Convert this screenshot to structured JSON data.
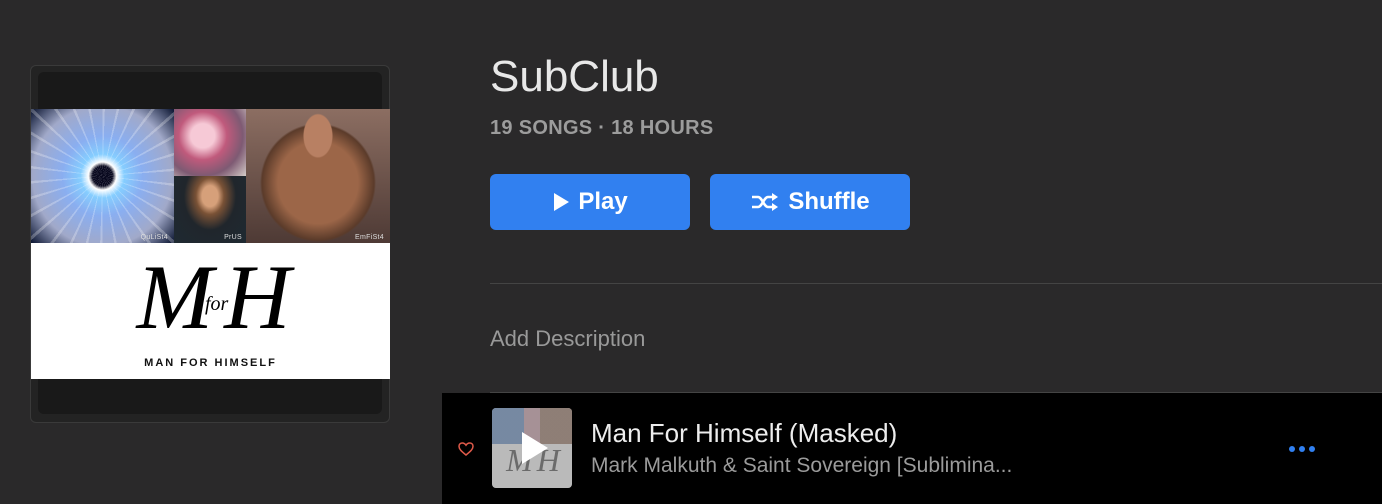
{
  "playlist": {
    "title": "SubClub",
    "meta": "19 SONGS · 18 HOURS",
    "add_description": "Add Description"
  },
  "buttons": {
    "play_label": "Play",
    "shuffle_label": "Shuffle"
  },
  "artwork": {
    "tile_labels": [
      "QuLiSt4",
      "PrUS",
      "EmFiSt4"
    ],
    "logo_text": "M H",
    "logo_for": "for",
    "logo_subtitle": "MAN FOR HIMSELF"
  },
  "track": {
    "title": "Man For Himself (Masked)",
    "artist": "Mark Malkuth & Saint Sovereign [Sublimina..."
  },
  "colors": {
    "accent": "#3180f0",
    "background": "#2a292a",
    "row_background": "#000000",
    "heart": "#e05a4a"
  },
  "icons": {
    "play": "play-icon",
    "shuffle": "shuffle-icon",
    "heart": "heart-icon",
    "more": "more-icon"
  }
}
